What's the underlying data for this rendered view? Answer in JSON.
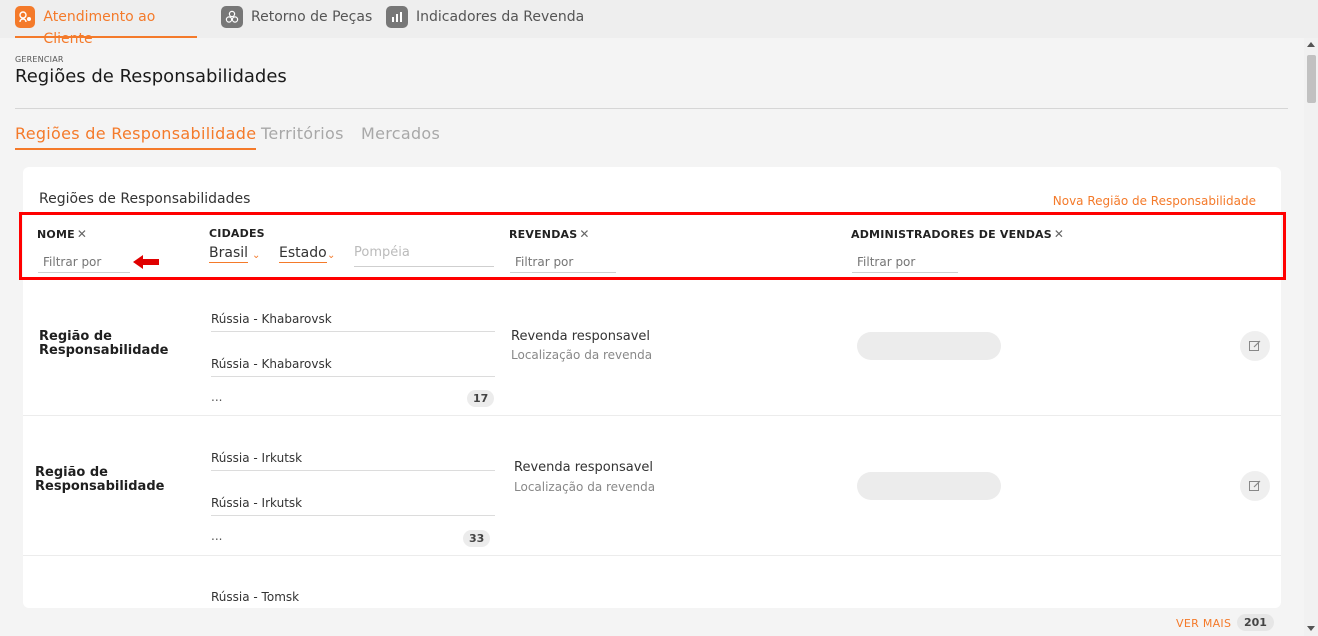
{
  "topnav": {
    "tabs": [
      {
        "label": "Atendimento ao Cliente",
        "icon": "customer-service-icon",
        "active": true
      },
      {
        "label": "Retorno de Peças",
        "icon": "parts-return-icon",
        "active": false
      },
      {
        "label": "Indicadores da Revenda",
        "icon": "bar-chart-icon",
        "active": false
      }
    ]
  },
  "header": {
    "section": "GERENCIAR",
    "title": "Regiões de Responsabilidades"
  },
  "subtabs": [
    {
      "label": "Regiões de Responsabilidade",
      "active": true
    },
    {
      "label": "Territórios",
      "active": false
    },
    {
      "label": "Mercados",
      "active": false
    }
  ],
  "card": {
    "title": "Regiões de Responsabilidades",
    "new_link": "Nova Região de Responsabilidade"
  },
  "filters": {
    "nome": {
      "label": "NOME",
      "placeholder": "Filtrar por"
    },
    "cidades": {
      "label": "CIDADES",
      "country": "Brasil",
      "state": "Estado",
      "city_placeholder": "Pompéia"
    },
    "revendas": {
      "label": "REVENDAS",
      "placeholder": "Filtrar por"
    },
    "administradores": {
      "label": "ADMINISTRADORES DE VENDAS",
      "placeholder": "Filtrar por"
    }
  },
  "rows": [
    {
      "name_line1": "Região de",
      "name_line2": "Responsabilidade",
      "city1": "Rússia - Khabarovsk",
      "city2": "Rússia - Khabarovsk",
      "more": "...",
      "count": "17",
      "revenda": "Revenda responsavel",
      "revenda_sub": "Localização da revenda"
    },
    {
      "name_line1": "Região de",
      "name_line2": "Responsabilidade",
      "city1": "Rússia - Irkutsk",
      "city2": "Rússia - Irkutsk",
      "more": "...",
      "count": "33",
      "revenda": "Revenda responsavel",
      "revenda_sub": "Localização da revenda"
    },
    {
      "city1": "Rússia - Tomsk"
    }
  ],
  "footer": {
    "ver_mais": "VER MAIS",
    "total": "201"
  },
  "colors": {
    "accent": "#f47a2a",
    "highlight_box": "#ff0000"
  }
}
